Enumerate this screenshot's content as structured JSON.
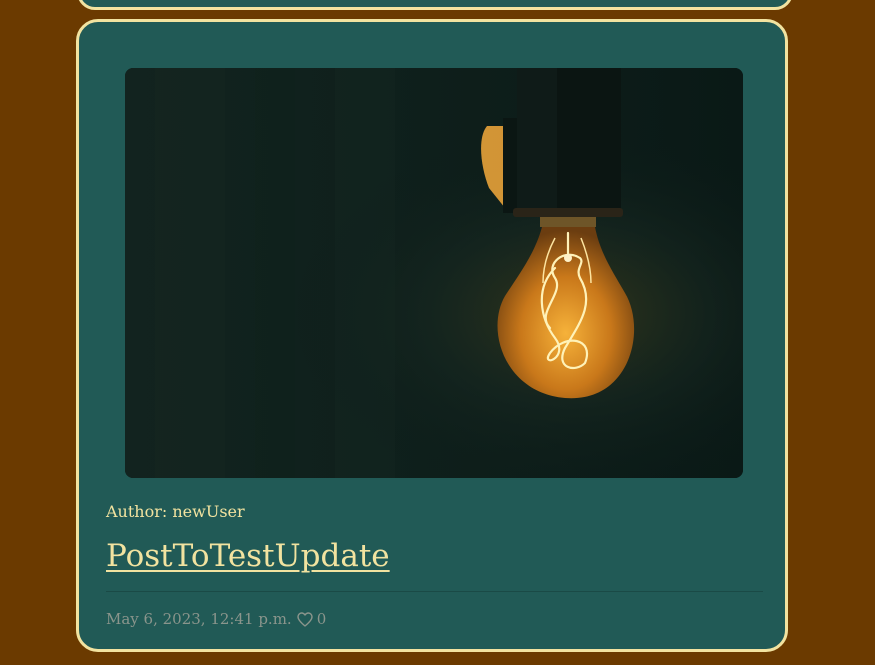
{
  "post": {
    "author_label": "Author:",
    "author_name": "newUser",
    "title": "PostToTestUpdate",
    "date": "May 6, 2023, 12:41 p.m.",
    "likes": "0",
    "image_icon": "light-bulb-image",
    "like_icon": "heart-outline-icon"
  },
  "colors": {
    "page_background": "#6b3a00",
    "card_background": "#215a56",
    "card_border": "#f2e3a0",
    "text_accent": "#f2e3a0",
    "meta_text": "#8a958c"
  }
}
